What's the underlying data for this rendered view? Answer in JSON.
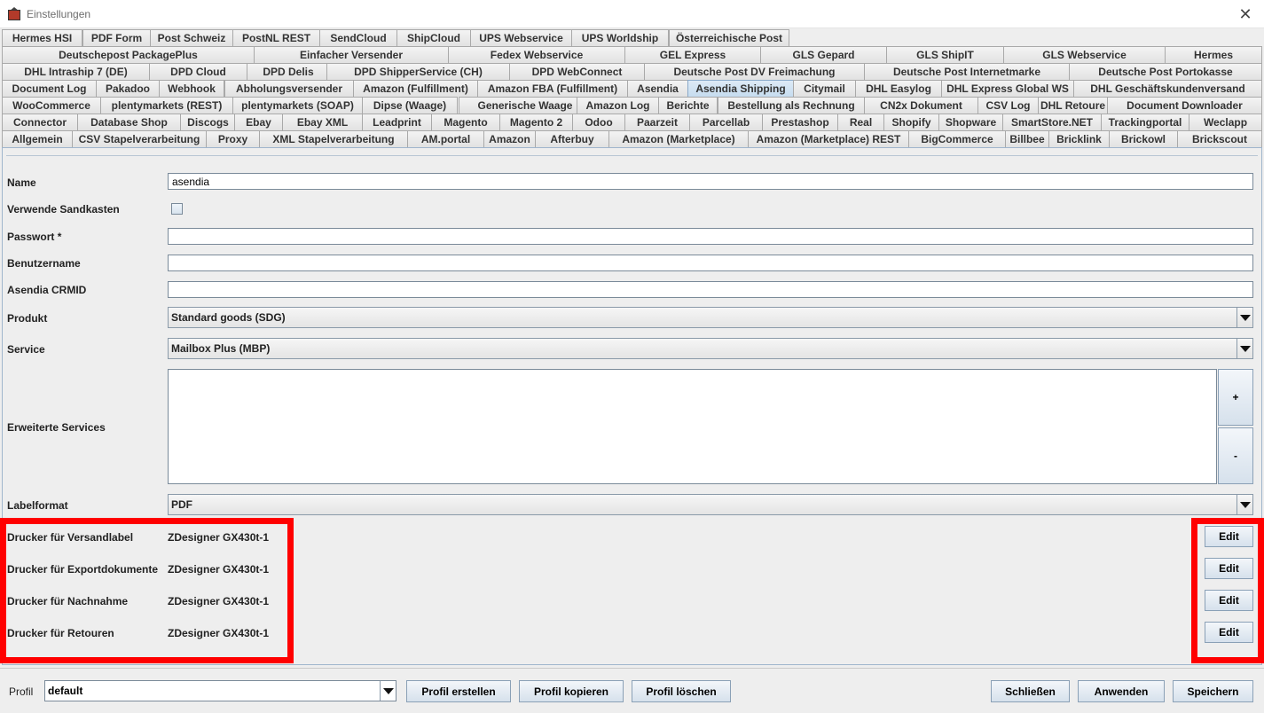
{
  "window": {
    "title": "Einstellungen"
  },
  "tabs": {
    "rows": [
      [
        "Hermes HSI",
        "PDF Form",
        "Post Schweiz",
        "PostNL REST",
        "SendCloud",
        "ShipCloud",
        "UPS Webservice",
        "UPS Worldship",
        "Österreichische Post"
      ],
      [
        "Deutschepost PackagePlus",
        "Einfacher Versender",
        "Fedex Webservice",
        "GEL Express",
        "GLS Gepard",
        "GLS ShipIT",
        "GLS Webservice",
        "Hermes"
      ],
      [
        "DHL Intraship 7 (DE)",
        "DPD Cloud",
        "DPD Delis",
        "DPD ShipperService (CH)",
        "DPD WebConnect",
        "Deutsche Post DV Freimachung",
        "Deutsche Post Internetmarke",
        "Deutsche Post Portokasse"
      ],
      [
        "Document Log",
        "Pakadoo",
        "Webhook",
        "Abholungsversender",
        "Amazon (Fulfillment)",
        "Amazon FBA (Fulfillment)",
        "Asendia",
        "Asendia Shipping",
        "Citymail",
        "DHL Easylog",
        "DHL Express Global WS",
        "DHL Geschäftskundenversand"
      ],
      [
        "WooCommerce",
        "plentymarkets (REST)",
        "plentymarkets (SOAP)",
        "Dipse (Waage)",
        "Generische Waage",
        "Amazon Log",
        "Berichte",
        "Bestellung als Rechnung",
        "CN2x Dokument",
        "CSV Log",
        "DHL Retoure",
        "Document Downloader"
      ],
      [
        "Connector",
        "Database Shop",
        "Discogs",
        "Ebay",
        "Ebay XML",
        "Leadprint",
        "Magento",
        "Magento 2",
        "Odoo",
        "Paarzeit",
        "Parcellab",
        "Prestashop",
        "Real",
        "Shopify",
        "Shopware",
        "SmartStore.NET",
        "Trackingportal",
        "Weclapp"
      ],
      [
        "Allgemein",
        "CSV Stapelverarbeitung",
        "Proxy",
        "XML Stapelverarbeitung",
        "AM.portal",
        "Amazon",
        "Afterbuy",
        "Amazon (Marketplace)",
        "Amazon (Marketplace) REST",
        "BigCommerce",
        "Billbee",
        "Bricklink",
        "Brickowl",
        "Brickscout"
      ]
    ],
    "selected": "Asendia Shipping"
  },
  "form": {
    "name_label": "Name",
    "name_value": "asendia",
    "sandbox_label": "Verwende Sandkasten",
    "password_label": "Passwort *",
    "username_label": "Benutzername",
    "crmid_label": "Asendia CRMID",
    "product_label": "Produkt",
    "product_value": "Standard goods (SDG)",
    "service_label": "Service",
    "service_value": "Mailbox Plus (MBP)",
    "extended_label": "Erweiterte Services",
    "add_label": "+",
    "remove_label": "-",
    "labelformat_label": "Labelformat",
    "labelformat_value": "PDF"
  },
  "printers": [
    {
      "label": "Drucker für Versandlabel",
      "value": "ZDesigner GX430t-1",
      "edit": "Edit"
    },
    {
      "label": "Drucker für Exportdokumente",
      "value": "ZDesigner GX430t-1",
      "edit": "Edit"
    },
    {
      "label": "Drucker für Nachnahme",
      "value": "ZDesigner GX430t-1",
      "edit": "Edit"
    },
    {
      "label": "Drucker für Retouren",
      "value": "ZDesigner GX430t-1",
      "edit": "Edit"
    }
  ],
  "footer": {
    "profile_label": "Profil",
    "profile_value": "default",
    "create": "Profil erstellen",
    "copy": "Profil kopieren",
    "delete": "Profil löschen",
    "close": "Schließen",
    "apply": "Anwenden",
    "save": "Speichern"
  },
  "colors": {
    "highlight": "#ff0000",
    "selected_tab": "#c6dcef"
  }
}
